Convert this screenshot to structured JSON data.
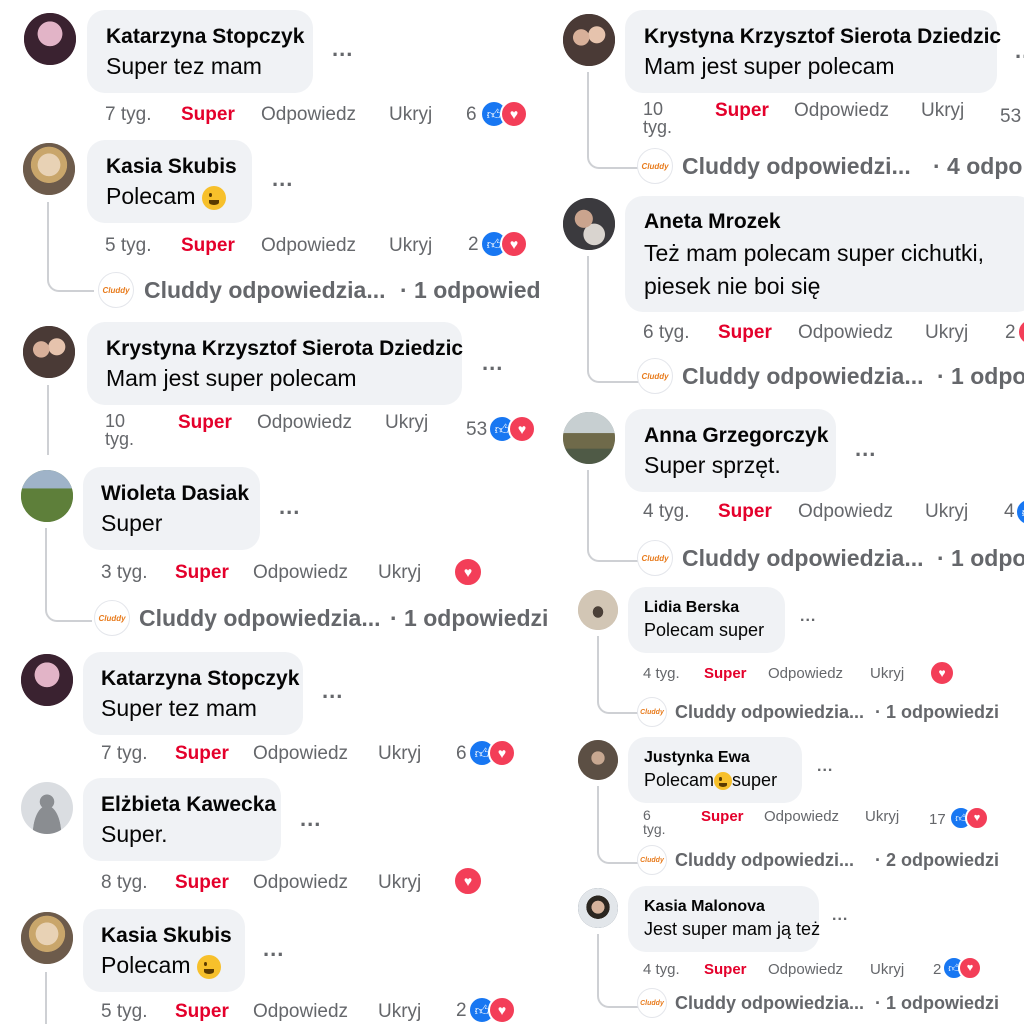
{
  "labels": {
    "like": "Super",
    "reply": "Odpowiedz",
    "hide": "Ukryj"
  },
  "colors": {
    "accent": "#e4002b",
    "bubble": "#f0f2f5",
    "like": "#1877f2",
    "love": "#f33e58",
    "meta": "#65676b"
  },
  "left": [
    {
      "author": "Katarzyna Stopczyk",
      "text": "Super tez mam",
      "time": "7 tyg.",
      "count": "6",
      "reactions": [
        "like",
        "love"
      ],
      "avatar": "avatar-woman-dark-hair"
    },
    {
      "author": "Kasia Skubis",
      "text": "Polecam",
      "emoji": "grinning-face-icon",
      "time": "5 tyg.",
      "count": "2",
      "reactions": [
        "like",
        "love"
      ],
      "avatar": "avatar-woman-blonde",
      "replies": {
        "text": "Cluddy odpowiedzia...",
        "count": "· 1 odpowied"
      }
    },
    {
      "author": "Krystyna Krzysztof Sierota Dziedzic",
      "text": "Mam jest super polecam",
      "time": "10 tyg.",
      "count": "53",
      "reactions": [
        "like",
        "love"
      ],
      "avatar": "avatar-couple"
    },
    {
      "author": "Wioleta Dasiak",
      "text": "Super",
      "time": "3 tyg.",
      "count": "",
      "reactions": [
        "love"
      ],
      "avatar": "avatar-outdoor",
      "replies": {
        "text": "Cluddy odpowiedzia...",
        "count": "· 1 odpowiedzi"
      }
    },
    {
      "author": "Katarzyna Stopczyk",
      "text": "Super tez mam",
      "time": "7 tyg.",
      "count": "6",
      "reactions": [
        "like",
        "love"
      ],
      "avatar": "avatar-woman-dark-hair"
    },
    {
      "author": "Elżbieta Kawecka",
      "text": "Super.",
      "time": "8 tyg.",
      "count": "",
      "reactions": [
        "love"
      ],
      "avatar": "avatar-default"
    },
    {
      "author": "Kasia Skubis",
      "text": "Polecam",
      "emoji": "grinning-face-icon",
      "time": "5 tyg.",
      "count": "2",
      "reactions": [
        "like",
        "love"
      ],
      "avatar": "avatar-woman-blonde"
    }
  ],
  "right": [
    {
      "author": "Krystyna Krzysztof Sierota Dziedzic",
      "text": "Mam jest super polecam",
      "time": "10 tyg.",
      "count": "53",
      "avatar": "avatar-couple",
      "replies": {
        "text": "Cluddy odpowiedzi...",
        "count": "· 4 odpo"
      }
    },
    {
      "author": "Aneta Mrozek",
      "text": "Też mam polecam super cichutki,",
      "text2": "piesek nie boi się",
      "time": "6 tyg.",
      "count": "2",
      "avatar": "avatar-woman-dog",
      "replies": {
        "text": "Cluddy odpowiedzia...",
        "count": "· 1 odpo"
      }
    },
    {
      "author": "Anna Grzegorczyk",
      "text": "Super sprzęt.",
      "time": "4 tyg.",
      "count": "4",
      "avatar": "avatar-landscape",
      "replies": {
        "text": "Cluddy odpowiedzia...",
        "count": "· 1 odpo"
      }
    },
    {
      "author": "Lidia Berska",
      "text": "Polecam super",
      "time": "4 tyg.",
      "count": "",
      "reactions": [
        "love"
      ],
      "avatar": "avatar-man-standing",
      "replies": {
        "text": "Cluddy odpowiedzia...",
        "count": "· 1 odpowiedzi"
      }
    },
    {
      "author": "Justynka Ewa",
      "text": "Polecam",
      "text_after": "super",
      "emoji": "smiling-face-icon",
      "time": "6 tyg.",
      "count": "17",
      "reactions": [
        "like",
        "love"
      ],
      "avatar": "avatar-woman-glasses",
      "replies": {
        "text": "Cluddy odpowiedzi...",
        "count": "· 2 odpowiedzi"
      }
    },
    {
      "author": "Kasia Malonova",
      "text": "Jest super mam ją też",
      "time": "4 tyg.",
      "count": "2",
      "reactions": [
        "like",
        "love"
      ],
      "avatar": "avatar-woman-portrait",
      "replies": {
        "text": "Cluddy odpowiedzia...",
        "count": "· 1 odpowiedzi"
      }
    }
  ],
  "brand": {
    "logo_text": "Cluddy"
  },
  "menu_glyph": "..."
}
